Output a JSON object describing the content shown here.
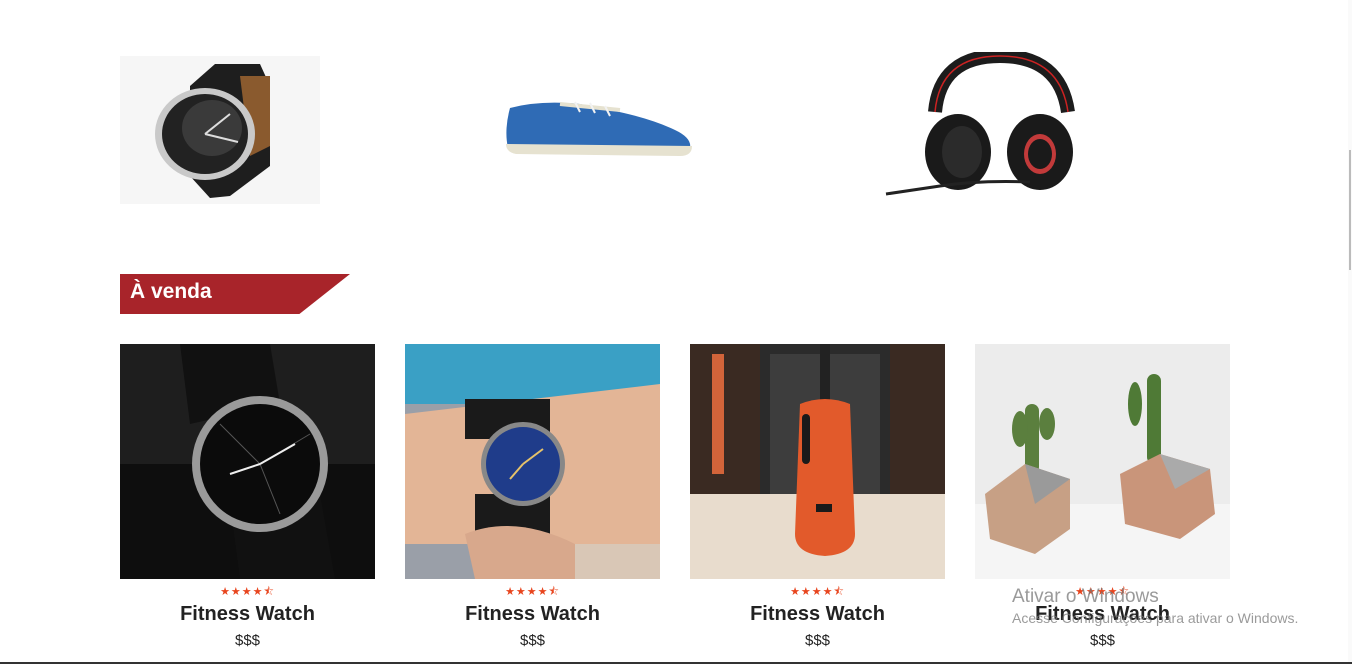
{
  "featured": [
    {
      "name": "watch",
      "kind": "watch-image"
    },
    {
      "name": "sneaker",
      "kind": "shoe-image"
    },
    {
      "name": "headset",
      "kind": "headphones-image"
    }
  ],
  "section": {
    "title": "À venda"
  },
  "products": [
    {
      "name": "Fitness Watch",
      "price": "$$$",
      "rating": 4.5,
      "stars": "★★★★⯪",
      "image": "black-watch-photo"
    },
    {
      "name": "Fitness Watch",
      "price": "$$$",
      "rating": 4.5,
      "stars": "★★★★⯪",
      "image": "blue-watch-on-wrist-photo"
    },
    {
      "name": "Fitness Watch",
      "price": "$$$",
      "rating": 4.5,
      "stars": "★★★★⯪",
      "image": "orange-guitar-photo"
    },
    {
      "name": "Fitness Watch",
      "price": "$$$",
      "rating": 4.5,
      "stars": "★★★★⯪",
      "image": "cactus-pots-photo"
    }
  ],
  "watermark": {
    "title": "Ativar o Windows",
    "subtitle": "Acesse Configurações para ativar o Windows."
  },
  "colors": {
    "accent": "#a8242a",
    "star": "#e8451e"
  }
}
